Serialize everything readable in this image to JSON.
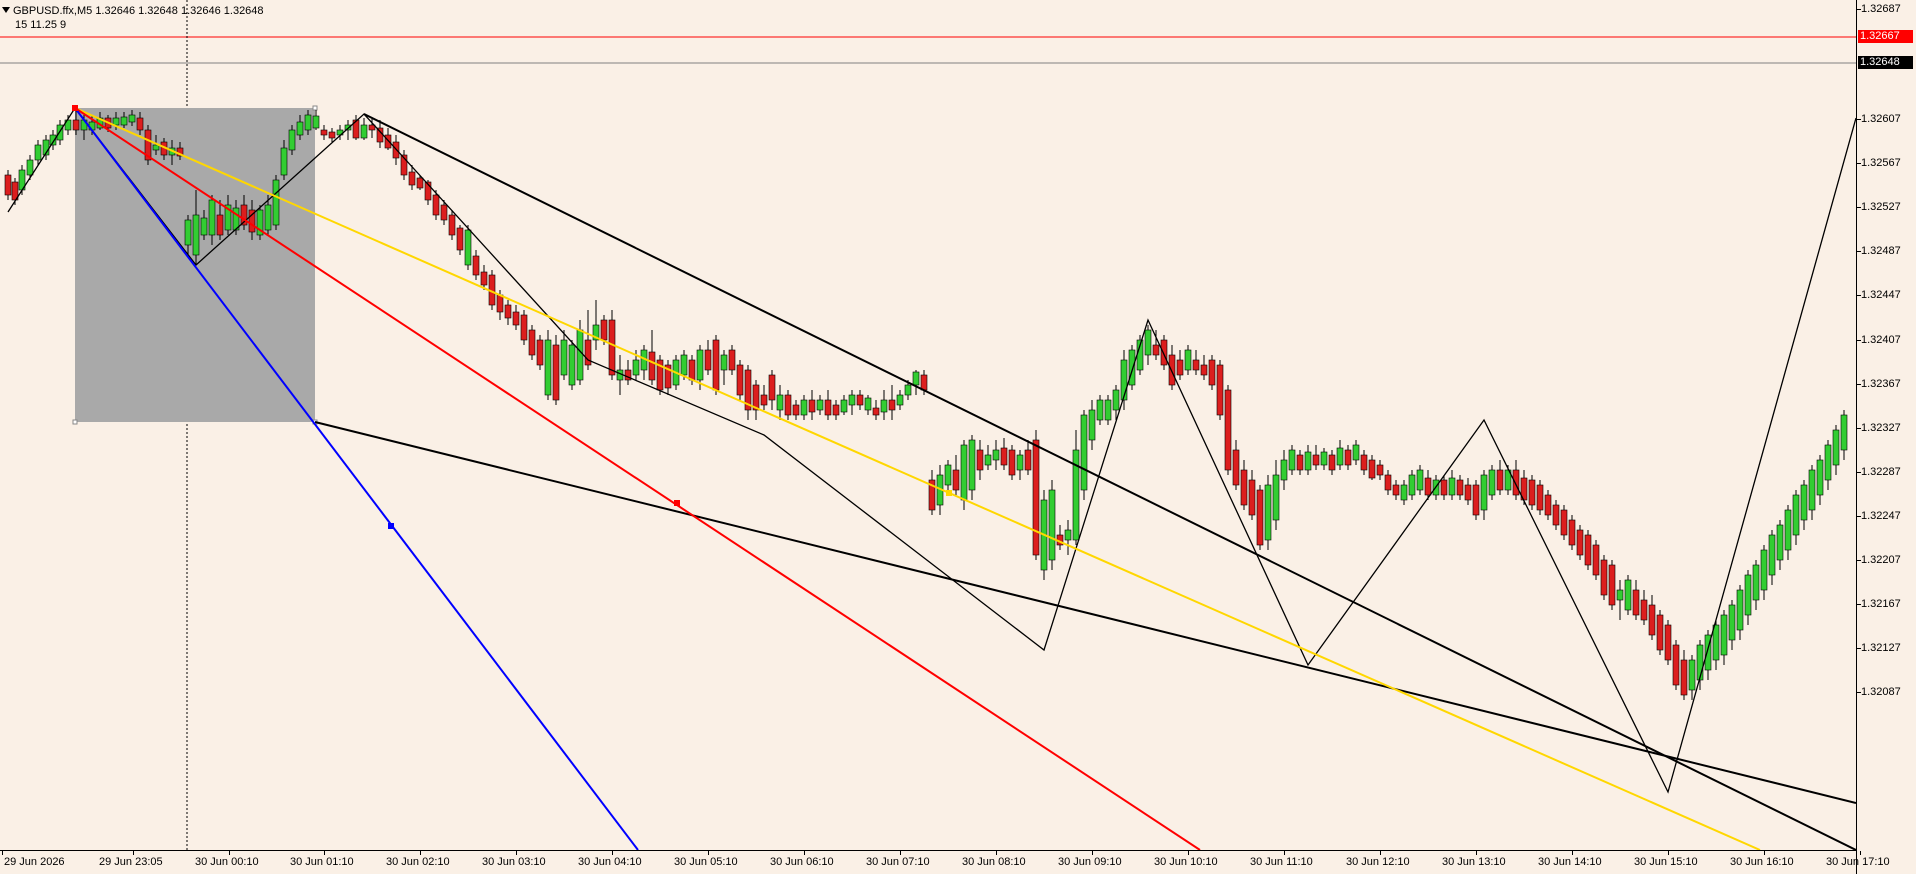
{
  "header": {
    "symbol_line": "GBPUSD.ffx,M5  1.32646 1.32648 1.32646 1.32648",
    "indicator_line": "15   11.25  9"
  },
  "price_scale": {
    "labels": [
      "1.32687",
      "1.32607",
      "1.32567",
      "1.32527",
      "1.32487",
      "1.32447",
      "1.32407",
      "1.32367",
      "1.32327",
      "1.32287",
      "1.32247",
      "1.32207",
      "1.32167",
      "1.32127",
      "1.32087"
    ],
    "ask_badge": "1.32667",
    "bid_badge": "1.32648"
  },
  "time_scale": {
    "labels": [
      "29 Jun 2026",
      "29 Jun 23:05",
      "30 Jun 00:10",
      "30 Jun 01:10",
      "30 Jun 02:10",
      "30 Jun 03:10",
      "30 Jun 04:10",
      "30 Jun 05:10",
      "30 Jun 06:10",
      "30 Jun 07:10",
      "30 Jun 08:10",
      "30 Jun 09:10",
      "30 Jun 10:10",
      "30 Jun 11:10",
      "30 Jun 12:10",
      "30 Jun 13:10",
      "30 Jun 14:10",
      "30 Jun 15:10",
      "30 Jun 16:10",
      "30 Jun 17:10"
    ]
  },
  "colors": {
    "background": "#FAF0E6",
    "bull": "#32CD32",
    "bear": "#DC1E1E",
    "zigzag": "#000000",
    "fan_yellow": "#FFD700",
    "fan_red": "#FF0000",
    "fan_blue": "#0000FF",
    "rectangle": "#A9A9A9",
    "ask_line": "#FF0000",
    "bid_line": "#808080"
  }
}
